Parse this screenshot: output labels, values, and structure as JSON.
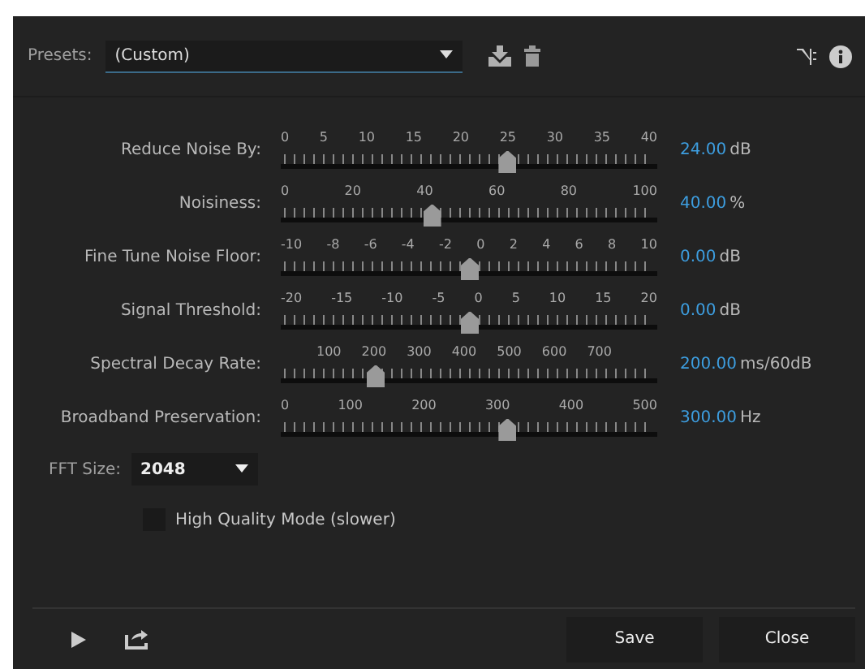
{
  "presets": {
    "label": "Presets:",
    "value": "(Custom)"
  },
  "sliders": [
    {
      "label": "Reduce Noise By:",
      "ticks": [
        "0",
        "5",
        "10",
        "15",
        "20",
        "25",
        "30",
        "35",
        "40"
      ],
      "kind": "full",
      "level": 0.6,
      "value": "24.00",
      "unit": "dB"
    },
    {
      "label": "Noisiness:",
      "ticks": [
        "0",
        "20",
        "40",
        "60",
        "80",
        "100"
      ],
      "kind": "full",
      "level": 0.4,
      "value": "40.00",
      "unit": "%"
    },
    {
      "label": "Fine Tune Noise Floor:",
      "ticks": [
        "-10",
        "-8",
        "-6",
        "-4",
        "-2",
        "0",
        "2",
        "4",
        "6",
        "8",
        "10"
      ],
      "kind": "full",
      "level": 0.5,
      "value": "0.00",
      "unit": "dB"
    },
    {
      "label": "Signal Threshold:",
      "ticks": [
        "-20",
        "-15",
        "-10",
        "-5",
        "0",
        "5",
        "10",
        "15",
        "20"
      ],
      "kind": "full",
      "level": 0.5,
      "value": "0.00",
      "unit": "dB"
    },
    {
      "label": "Spectral Decay Rate:",
      "ticks": [
        "100",
        "200",
        "300",
        "400",
        "500",
        "600",
        "700"
      ],
      "kind": "inset",
      "level": 0.25,
      "value": "200.00",
      "unit": "ms/60dB"
    },
    {
      "label": "Broadband Preservation:",
      "ticks": [
        "0",
        "100",
        "200",
        "300",
        "400",
        "500"
      ],
      "kind": "full",
      "level": 0.6,
      "value": "300.00",
      "unit": "Hz"
    }
  ],
  "fft_size": {
    "label": "FFT Size:",
    "value": "2048"
  },
  "high_quality": {
    "label": "High Quality Mode (slower)",
    "checked": false
  },
  "buttons": [
    "Save",
    "Close"
  ]
}
